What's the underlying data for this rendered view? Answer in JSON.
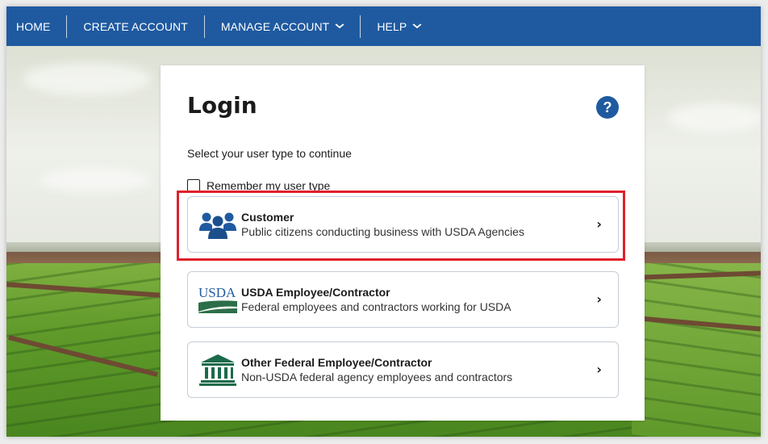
{
  "nav": {
    "items": [
      {
        "label": "HOME"
      },
      {
        "label": "CREATE ACCOUNT"
      },
      {
        "label": "MANAGE ACCOUNT",
        "chevron": "⌄"
      },
      {
        "label": "HELP",
        "chevron": "⌄"
      }
    ]
  },
  "login": {
    "title": "Login",
    "help_icon": "?",
    "subtitle": "Select your user type to continue",
    "remember_label": "Remember my user type",
    "options": [
      {
        "icon": "people-icon",
        "title": "Customer",
        "description": "Public citizens conducting business with USDA Agencies",
        "arrow": "›"
      },
      {
        "icon": "usda-logo-icon",
        "logo_text": "USDA",
        "title": "USDA Employee/Contractor",
        "description": "Federal employees and contractors working for USDA",
        "arrow": "›"
      },
      {
        "icon": "government-building-icon",
        "title": "Other Federal Employee/Contractor",
        "description": "Non-USDA federal agency employees and contractors",
        "arrow": "›"
      }
    ]
  },
  "colors": {
    "nav_bg": "#1f5aa0",
    "customer_icon": "#1f5aa0",
    "usda_logo": "#2c6e49",
    "federal_icon": "#1a6b4a",
    "highlight": "#e0202a"
  }
}
